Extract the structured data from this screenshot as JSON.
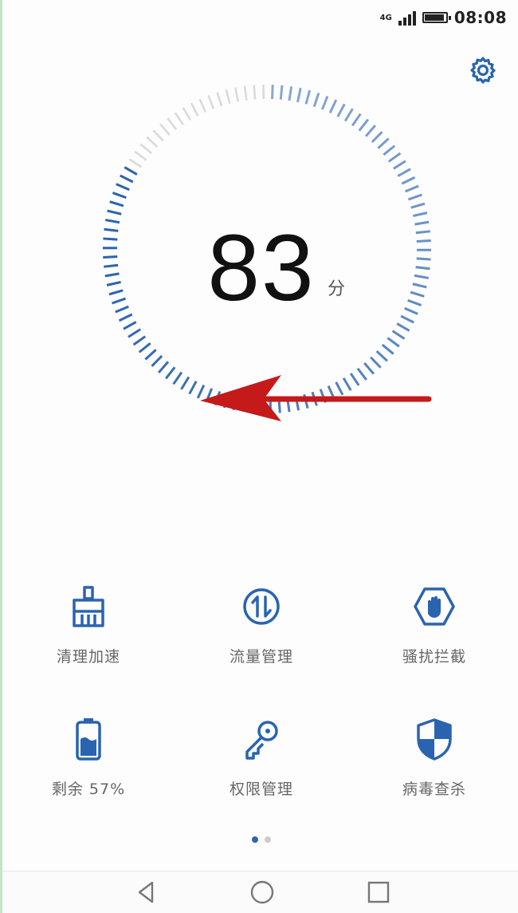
{
  "status_bar": {
    "network": "4G",
    "time": "08:08",
    "battery_level": 0.85
  },
  "score": {
    "value": "83",
    "unit": "分"
  },
  "tiles": [
    {
      "label": "清理加速",
      "icon": "broom-icon"
    },
    {
      "label": "流量管理",
      "icon": "data-traffic-icon"
    },
    {
      "label": "骚扰拦截",
      "icon": "hand-block-icon"
    },
    {
      "label": "剩余 57%",
      "icon": "battery-icon"
    },
    {
      "label": "权限管理",
      "icon": "key-icon"
    },
    {
      "label": "病毒查杀",
      "icon": "shield-icon"
    }
  ],
  "pager": {
    "pages": 2,
    "current": 0
  },
  "colors": {
    "accent": "#2a64b0",
    "arrow": "#c41a1a",
    "track": "#dadada"
  },
  "gauge": {
    "score_fraction": 0.83
  }
}
